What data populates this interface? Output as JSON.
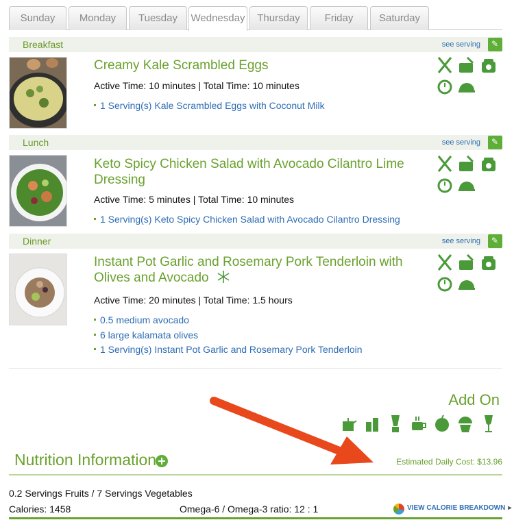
{
  "tabs": [
    "Sunday",
    "Monday",
    "Tuesday",
    "Wednesday",
    "Thursday",
    "Friday",
    "Saturday"
  ],
  "active_tab": "Wednesday",
  "see_serving_label": "see serving",
  "meals": [
    {
      "name": "Breakfast",
      "title": "Creamy Kale Scrambled Eggs",
      "times": "Active Time: 10 minutes | Total Time: 10 minutes",
      "ingredients": [
        "1 Serving(s) Kale Scrambled Eggs with Coconut Milk"
      ]
    },
    {
      "name": "Lunch",
      "title_line1": "Keto Spicy Chicken Salad with Avocado Cilantro Lime",
      "title_line2": "Dressing",
      "times": "Active Time: 5 minutes | Total Time: 10 minutes",
      "ingredients": [
        "1 Serving(s) Keto Spicy Chicken Salad with Avocado Cilantro Dressing"
      ]
    },
    {
      "name": "Dinner",
      "title_line1": "Instant Pot Garlic and Rosemary Pork Tenderloin with",
      "title_line2": "Olives and Avocado",
      "times": "Active Time: 20 minutes | Total Time: 1.5 hours",
      "ingredients": [
        "0.5 medium avocado",
        "6 large kalamata olives",
        "1 Serving(s) Instant Pot Garlic and Rosemary Pork Tenderloin"
      ]
    }
  ],
  "recipe_icons": [
    "utensils-icon",
    "cooking-pot-icon",
    "slow-cooker-icon",
    "timer-icon",
    "serving-cloche-icon"
  ],
  "add_on": {
    "title": "Add On",
    "icons": [
      "teapot-icon",
      "drinks-icon",
      "blender-icon",
      "coffee-cup-icon",
      "apple-icon",
      "cupcake-icon",
      "wine-glass-icon"
    ]
  },
  "nutrition": {
    "title": "Nutrition Information",
    "cost": "Estimated Daily Cost: $13.96",
    "servings": "0.2 Servings Fruits / 7 Servings Vegetables",
    "calories": "Calories: 1458",
    "omega": "Omega-6 / Omega-3 ratio: 12 : 1",
    "breakdown_label": "VIEW CALORIE BREAKDOWN"
  },
  "colors": {
    "accent_green": "#6aa12e",
    "link_blue": "#2e6db4",
    "annotation_arrow": "#e8481c"
  }
}
